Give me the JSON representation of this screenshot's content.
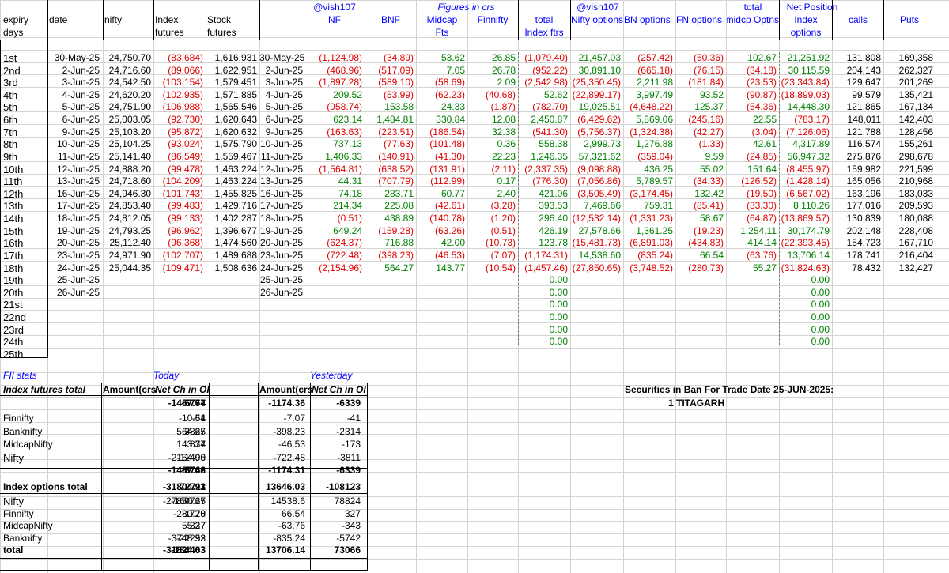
{
  "top_tags": {
    "handle_left": "@vish107",
    "figures_in_crs": "Figures in crs",
    "handle_right": "@vish107",
    "total_above": "total",
    "net_position": "Net Position"
  },
  "headers": {
    "expiry": "expiry",
    "days": "days",
    "date": "date",
    "nifty": "nifty",
    "index_fut_1": "Index",
    "index_fut_2": "futures",
    "stock_fut_1": "Stock",
    "stock_fut_2": "futures",
    "nf": "NF",
    "bnf": "BNF",
    "midcap_1": "Midcap",
    "midcap_2": "Fts",
    "finnifty": "Finnifty",
    "total_idx_1": "total",
    "total_idx_2": "Index ftrs",
    "nifty_options": "Nifty options",
    "bn_options": "BN options",
    "fn_options": "FN options",
    "midcap_options": "midcp Optns",
    "index_options_1": "Index",
    "index_options_2": "options",
    "calls": "calls",
    "puts": "Puts"
  },
  "rows": [
    {
      "day": "1st",
      "date": "30-May-25",
      "nifty": "24,750.70",
      "idx": "(83,684)",
      "stk": "1,616,931",
      "date2": "30-May-25",
      "nf": "(1,124.98)",
      "bnf": "(34.89)",
      "mid": "53.62",
      "fin": "26.85",
      "tot": "(1,079.40)",
      "nopt": "21,457.03",
      "bnopt": "(257.42)",
      "fnopt": "(50.36)",
      "midopt": "102.67",
      "iopt": "21,251.92",
      "calls": "131,808",
      "puts": "169,358"
    },
    {
      "day": "2nd",
      "date": "2-Jun-25",
      "nifty": "24,716.60",
      "idx": "(89,066)",
      "stk": "1,622,951",
      "date2": "2-Jun-25",
      "nf": "(468.96)",
      "bnf": "(517.09)",
      "mid": "7.05",
      "fin": "26.78",
      "tot": "(952.22)",
      "nopt": "30,891.10",
      "bnopt": "(665.18)",
      "fnopt": "(76.15)",
      "midopt": "(34.18)",
      "iopt": "30,115.59",
      "calls": "204,143",
      "puts": "262,327"
    },
    {
      "day": "3rd",
      "date": "3-Jun-25",
      "nifty": "24,542.50",
      "idx": "(103,154)",
      "stk": "1,579,451",
      "date2": "3-Jun-25",
      "nf": "(1,897.28)",
      "bnf": "(589.10)",
      "mid": "(58.69)",
      "fin": "2.09",
      "tot": "(2,542.98)",
      "nopt": "(25,350.45)",
      "bnopt": "2,211.98",
      "fnopt": "(181.84)",
      "midopt": "(23.53)",
      "iopt": "(23,343.84)",
      "calls": "129,647",
      "puts": "201,269"
    },
    {
      "day": "4th",
      "date": "4-Jun-25",
      "nifty": "24,620.20",
      "idx": "(102,935)",
      "stk": "1,571,885",
      "date2": "4-Jun-25",
      "nf": "209.52",
      "bnf": "(53.99)",
      "mid": "(62.23)",
      "fin": "(40.68)",
      "tot": "52.62",
      "nopt": "(22,899.17)",
      "bnopt": "3,997.49",
      "fnopt": "93.52",
      "midopt": "(90.87)",
      "iopt": "(18,899.03)",
      "calls": "99,579",
      "puts": "135,421"
    },
    {
      "day": "5th",
      "date": "5-Jun-25",
      "nifty": "24,751.90",
      "idx": "(106,988)",
      "stk": "1,565,546",
      "date2": "5-Jun-25",
      "nf": "(958.74)",
      "bnf": "153.58",
      "mid": "24.33",
      "fin": "(1.87)",
      "tot": "(782.70)",
      "nopt": "19,025.51",
      "bnopt": "(4,648.22)",
      "fnopt": "125.37",
      "midopt": "(54.36)",
      "iopt": "14,448.30",
      "calls": "121,865",
      "puts": "167,134"
    },
    {
      "day": "6th",
      "date": "6-Jun-25",
      "nifty": "25,003.05",
      "idx": "(92,730)",
      "stk": "1,620,643",
      "date2": "6-Jun-25",
      "nf": "623.14",
      "bnf": "1,484.81",
      "mid": "330.84",
      "fin": "12.08",
      "tot": "2,450.87",
      "nopt": "(6,429.62)",
      "bnopt": "5,869.06",
      "fnopt": "(245.16)",
      "midopt": "22.55",
      "iopt": "(783.17)",
      "calls": "148,011",
      "puts": "142,403"
    },
    {
      "day": "7th",
      "date": "9-Jun-25",
      "nifty": "25,103.20",
      "idx": "(95,872)",
      "stk": "1,620,632",
      "date2": "9-Jun-25",
      "nf": "(163.63)",
      "bnf": "(223.51)",
      "mid": "(186.54)",
      "fin": "32.38",
      "tot": "(541.30)",
      "nopt": "(5,756.37)",
      "bnopt": "(1,324.38)",
      "fnopt": "(42.27)",
      "midopt": "(3.04)",
      "iopt": "(7,126.06)",
      "calls": "121,788",
      "puts": "128,456"
    },
    {
      "day": "8th",
      "date": "10-Jun-25",
      "nifty": "25,104.25",
      "idx": "(93,024)",
      "stk": "1,575,790",
      "date2": "10-Jun-25",
      "nf": "737.13",
      "bnf": "(77.63)",
      "mid": "(101.48)",
      "fin": "0.36",
      "tot": "558.38",
      "nopt": "2,999.73",
      "bnopt": "1,276.88",
      "fnopt": "(1.33)",
      "midopt": "42.61",
      "iopt": "4,317.89",
      "calls": "116,574",
      "puts": "155,261"
    },
    {
      "day": "9th",
      "date": "11-Jun-25",
      "nifty": "25,141.40",
      "idx": "(86,549)",
      "stk": "1,559,467",
      "date2": "11-Jun-25",
      "nf": "1,406.33",
      "bnf": "(140.91)",
      "mid": "(41.30)",
      "fin": "22.23",
      "tot": "1,246.35",
      "nopt": "57,321.62",
      "bnopt": "(359.04)",
      "fnopt": "9.59",
      "midopt": "(24.85)",
      "iopt": "56,947.32",
      "calls": "275,876",
      "puts": "298,678"
    },
    {
      "day": "10th",
      "date": "12-Jun-25",
      "nifty": "24,888.20",
      "idx": "(99,478)",
      "stk": "1,463,224",
      "date2": "12-Jun-25",
      "nf": "(1,564.81)",
      "bnf": "(638.52)",
      "mid": "(131.91)",
      "fin": "(2.11)",
      "tot": "(2,337.35)",
      "nopt": "(9,098.88)",
      "bnopt": "436.25",
      "fnopt": "55.02",
      "midopt": "151.64",
      "iopt": "(8,455.97)",
      "calls": "159,982",
      "puts": "221,599"
    },
    {
      "day": "11th",
      "date": "13-Jun-25",
      "nifty": "24,718.60",
      "idx": "(104,209)",
      "stk": "1,463,224",
      "date2": "13-Jun-25",
      "nf": "44.31",
      "bnf": "(707.79)",
      "mid": "(112.99)",
      "fin": "0.17",
      "tot": "(776.30)",
      "nopt": "(7,056.86)",
      "bnopt": "5,789.57",
      "fnopt": "(34.33)",
      "midopt": "(126.52)",
      "iopt": "(1,428.14)",
      "calls": "165,056",
      "puts": "210,968"
    },
    {
      "day": "12th",
      "date": "16-Jun-25",
      "nifty": "24,946.30",
      "idx": "(101,743)",
      "stk": "1,455,825",
      "date2": "16-Jun-25",
      "nf": "74.18",
      "bnf": "283.71",
      "mid": "60.77",
      "fin": "2.40",
      "tot": "421.06",
      "nopt": "(3,505.49)",
      "bnopt": "(3,174.45)",
      "fnopt": "132.42",
      "midopt": "(19.50)",
      "iopt": "(6,567.02)",
      "calls": "163,196",
      "puts": "183,033"
    },
    {
      "day": "13th",
      "date": "17-Jun-25",
      "nifty": "24,853.40",
      "idx": "(99,483)",
      "stk": "1,429,716",
      "date2": "17-Jun-25",
      "nf": "214.34",
      "bnf": "225.08",
      "mid": "(42.61)",
      "fin": "(3.28)",
      "tot": "393.53",
      "nopt": "7,469.66",
      "bnopt": "759.31",
      "fnopt": "(85.41)",
      "midopt": "(33.30)",
      "iopt": "8,110.26",
      "calls": "177,016",
      "puts": "209,593"
    },
    {
      "day": "14th",
      "date": "18-Jun-25",
      "nifty": "24,812.05",
      "idx": "(99,133)",
      "stk": "1,402,287",
      "date2": "18-Jun-25",
      "nf": "(0.51)",
      "bnf": "438.89",
      "mid": "(140.78)",
      "fin": "(1.20)",
      "tot": "296.40",
      "nopt": "(12,532.14)",
      "bnopt": "(1,331.23)",
      "fnopt": "58.67",
      "midopt": "(64.87)",
      "iopt": "(13,869.57)",
      "calls": "130,839",
      "puts": "180,088"
    },
    {
      "day": "15th",
      "date": "19-Jun-25",
      "nifty": "24,793.25",
      "idx": "(96,962)",
      "stk": "1,396,677",
      "date2": "19-Jun-25",
      "nf": "649.24",
      "bnf": "(159.28)",
      "mid": "(63.26)",
      "fin": "(0.51)",
      "tot": "426.19",
      "nopt": "27,578.66",
      "bnopt": "1,361.25",
      "fnopt": "(19.23)",
      "midopt": "1,254.11",
      "iopt": "30,174.79",
      "calls": "202,148",
      "puts": "228,408"
    },
    {
      "day": "16th",
      "date": "20-Jun-25",
      "nifty": "25,112.40",
      "idx": "(96,368)",
      "stk": "1,474,560",
      "date2": "20-Jun-25",
      "nf": "(624.37)",
      "bnf": "716.88",
      "mid": "42.00",
      "fin": "(10.73)",
      "tot": "123.78",
      "nopt": "(15,481.73)",
      "bnopt": "(6,891.03)",
      "fnopt": "(434.83)",
      "midopt": "414.14",
      "iopt": "(22,393.45)",
      "calls": "154,723",
      "puts": "167,710"
    },
    {
      "day": "17th",
      "date": "23-Jun-25",
      "nifty": "24,971.90",
      "idx": "(102,707)",
      "stk": "1,489,688",
      "date2": "23-Jun-25",
      "nf": "(722.48)",
      "bnf": "(398.23)",
      "mid": "(46.53)",
      "fin": "(7.07)",
      "tot": "(1,174.31)",
      "nopt": "14,538.60",
      "bnopt": "(835.24)",
      "fnopt": "66.54",
      "midopt": "(63.76)",
      "iopt": "13,706.14",
      "calls": "178,741",
      "puts": "216,404"
    },
    {
      "day": "18th",
      "date": "24-Jun-25",
      "nifty": "25,044.35",
      "idx": "(109,471)",
      "stk": "1,508,636",
      "date2": "24-Jun-25",
      "nf": "(2,154.96)",
      "bnf": "564.27",
      "mid": "143.77",
      "fin": "(10.54)",
      "tot": "(1,457.46)",
      "nopt": "(27,850.65)",
      "bnopt": "(3,748.52)",
      "fnopt": "(280.73)",
      "midopt": "55.27",
      "iopt": "(31,824.63)",
      "calls": "78,432",
      "puts": "132,427"
    },
    {
      "day": "19th",
      "date": "25-Jun-25",
      "nifty": "",
      "idx": "",
      "stk": "",
      "date2": "25-Jun-25",
      "nf": "",
      "bnf": "",
      "mid": "",
      "fin": "",
      "tot": "0.00",
      "nopt": "",
      "bnopt": "",
      "fnopt": "",
      "midopt": "",
      "iopt": "0.00",
      "calls": "",
      "puts": ""
    },
    {
      "day": "20th",
      "date": "26-Jun-25",
      "nifty": "",
      "idx": "",
      "stk": "",
      "date2": "26-Jun-25",
      "nf": "",
      "bnf": "",
      "mid": "",
      "fin": "",
      "tot": "0.00",
      "nopt": "",
      "bnopt": "",
      "fnopt": "",
      "midopt": "",
      "iopt": "0.00",
      "calls": "",
      "puts": ""
    },
    {
      "day": "21st",
      "date": "",
      "nifty": "",
      "idx": "",
      "stk": "",
      "date2": "",
      "nf": "",
      "bnf": "",
      "mid": "",
      "fin": "",
      "tot": "0.00",
      "nopt": "",
      "bnopt": "",
      "fnopt": "",
      "midopt": "",
      "iopt": "0.00",
      "calls": "",
      "puts": ""
    },
    {
      "day": "22nd",
      "date": "",
      "nifty": "",
      "idx": "",
      "stk": "",
      "date2": "",
      "nf": "",
      "bnf": "",
      "mid": "",
      "fin": "",
      "tot": "0.00",
      "nopt": "",
      "bnopt": "",
      "fnopt": "",
      "midopt": "",
      "iopt": "0.00",
      "calls": "",
      "puts": ""
    },
    {
      "day": "23rd",
      "date": "",
      "nifty": "",
      "idx": "",
      "stk": "",
      "date2": "",
      "nf": "",
      "bnf": "",
      "mid": "",
      "fin": "",
      "tot": "0.00",
      "nopt": "",
      "bnopt": "",
      "fnopt": "",
      "midopt": "",
      "iopt": "0.00",
      "calls": "",
      "puts": ""
    },
    {
      "day": "24th",
      "date": "",
      "nifty": "",
      "idx": "",
      "stk": "",
      "date2": "",
      "nf": "",
      "bnf": "",
      "mid": "",
      "fin": "",
      "tot": "0.00",
      "nopt": "",
      "bnopt": "",
      "fnopt": "",
      "midopt": "",
      "iopt": "0.00",
      "calls": "",
      "puts": ""
    },
    {
      "day": "25th",
      "date": "",
      "nifty": "",
      "idx": "",
      "stk": "",
      "date2": "",
      "nf": "",
      "bnf": "",
      "mid": "",
      "fin": "",
      "tot": "",
      "nopt": "",
      "bnopt": "",
      "fnopt": "",
      "midopt": "",
      "iopt": "",
      "calls": "",
      "puts": ""
    }
  ],
  "fii": {
    "title": "FII stats",
    "today": "Today",
    "yesterday": "Yesterday",
    "futures_header": "Index futures total",
    "amount_header": "Amount(crs",
    "netch_header": "Net Ch in OI",
    "futures_total": {
      "t_amt": "-1457.77",
      "t_oi": "-6764",
      "y_amt": "-1174.36",
      "y_oi": "-6339"
    },
    "futures_rows": [
      {
        "label": "Finnifty",
        "t_amt": "-10.54",
        "t_oi": "-61",
        "y_amt": "-7.07",
        "y_oi": "-41"
      },
      {
        "label": "Banknifty",
        "t_amt": "564.27",
        "t_oi": "3865",
        "y_amt": "-398.23",
        "y_oi": "-2314"
      },
      {
        "label": "MidcapNifty",
        "t_amt": "143.77",
        "t_oi": "834",
        "y_amt": "-46.53",
        "y_oi": "-173"
      },
      {
        "label": "Nifty",
        "t_amt": "-2154.96",
        "t_oi": "-11400",
        "y_amt": "-722.48",
        "y_oi": "-3811"
      },
      {
        "label": "",
        "t_amt": "-1457.46",
        "t_oi": "-6762",
        "y_amt": "-1174.31",
        "y_oi": "-6339"
      }
    ],
    "options_header": "Index options total",
    "options_total": {
      "t_amt": "-31804.93",
      "t_oi": "72711",
      "y_amt": "13646.03",
      "y_oi": "-108123"
    },
    "options_rows": [
      {
        "label": "Nifty",
        "t_amt": "-27850.65",
        "t_oi": "-160727",
        "y_amt": "14538.6",
        "y_oi": "78824"
      },
      {
        "label": "Finnifty",
        "t_amt": "-280.73",
        "t_oi": "-1720",
        "y_amt": "66.54",
        "y_oi": "327"
      },
      {
        "label": "MidcapNifty",
        "t_amt": "55.27",
        "t_oi": "337",
        "y_amt": "-63.76",
        "y_oi": "-343"
      },
      {
        "label": "Banknifty",
        "t_amt": "-3748.52",
        "t_oi": "-22293",
        "y_amt": "-835.24",
        "y_oi": "-5742"
      },
      {
        "label": "total",
        "t_amt": "-31824.63",
        "t_oi": "-184403",
        "y_amt": "13706.14",
        "y_oi": "73066"
      }
    ]
  },
  "ban": {
    "title": "Securities in Ban For Trade Date 25-JUN-2025:",
    "item": "1 TITAGARH"
  },
  "colors": {
    "negative": "#e00000",
    "positive": "#008000",
    "heading_blue": "#0000ff",
    "gridline": "#d4d4d4"
  }
}
